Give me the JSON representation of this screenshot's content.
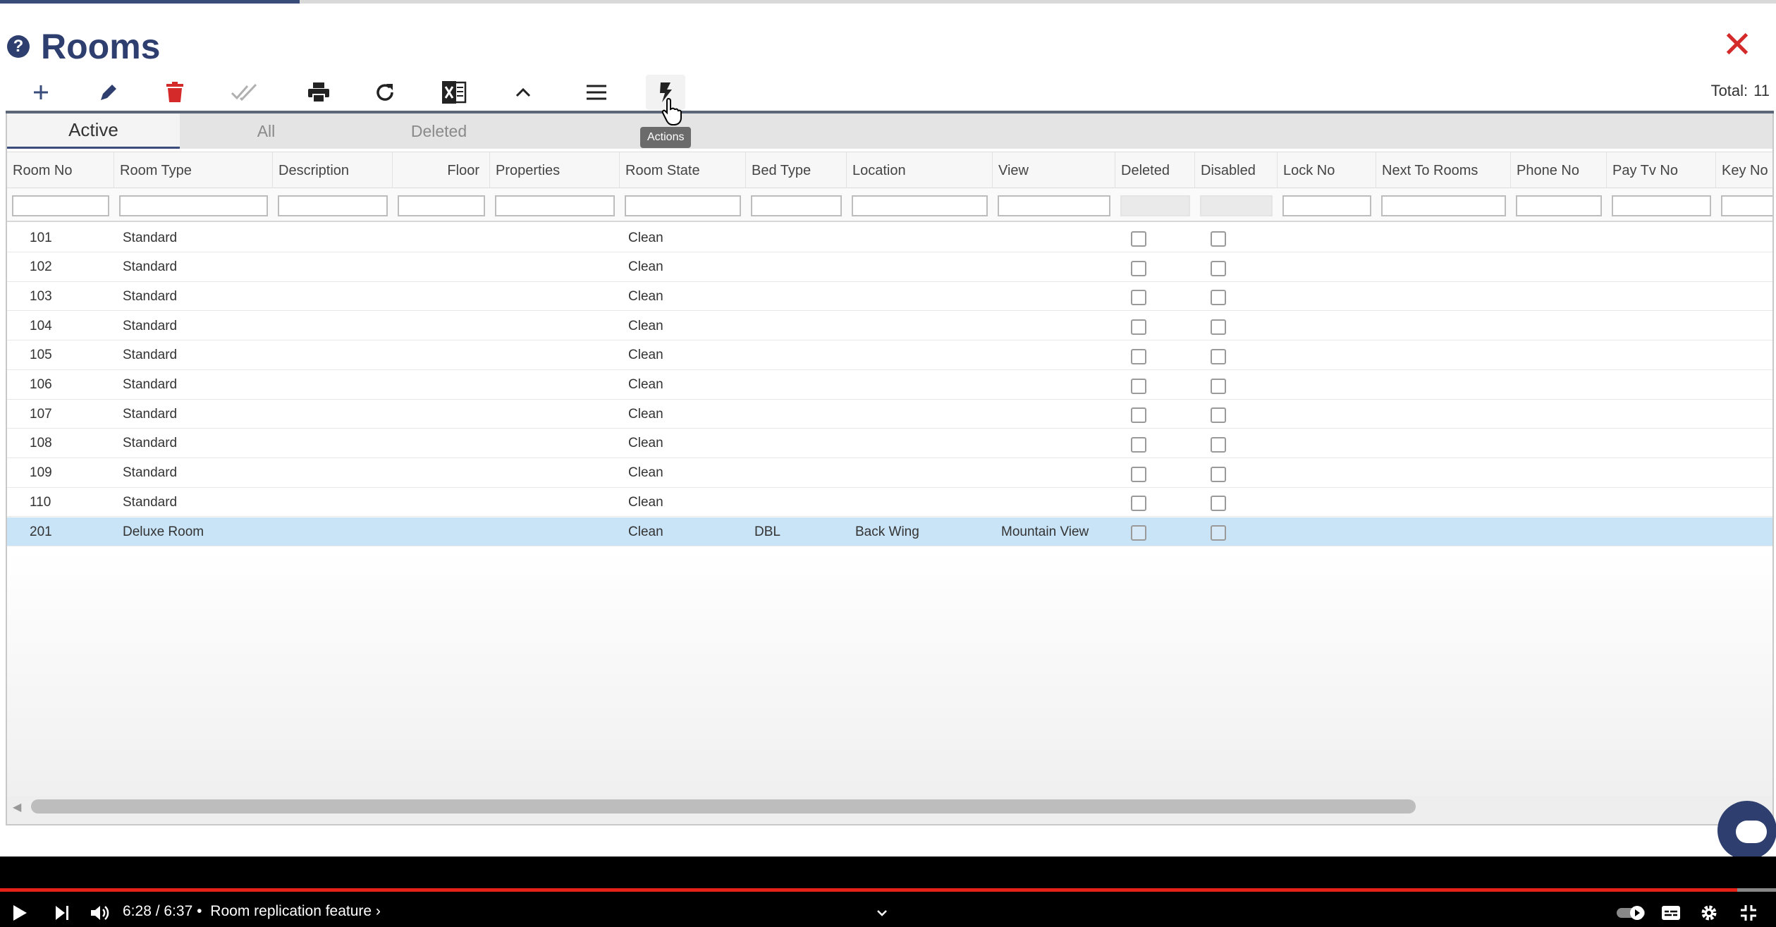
{
  "page": {
    "title": "Rooms",
    "help_icon": "?",
    "close_icon": "✕"
  },
  "toolbar": {
    "buttons": [
      {
        "name": "add",
        "icon": "plus-icon",
        "color": "#3a4d7a"
      },
      {
        "name": "edit",
        "icon": "pencil-icon",
        "color": "#2e3f6f"
      },
      {
        "name": "delete",
        "icon": "trash-icon",
        "color": "#d42a2a"
      },
      {
        "name": "approve",
        "icon": "double-check-icon",
        "color": "#b0b0b0"
      },
      {
        "name": "print",
        "icon": "printer-icon",
        "color": "#222222"
      },
      {
        "name": "refresh",
        "icon": "refresh-icon",
        "color": "#222222"
      },
      {
        "name": "excel",
        "icon": "excel-icon",
        "color": "#222222"
      },
      {
        "name": "collapse",
        "icon": "chevron-up-icon",
        "color": "#222222"
      },
      {
        "name": "menu",
        "icon": "hamburger-icon",
        "color": "#222222"
      },
      {
        "name": "actions",
        "icon": "bolt-icon",
        "color": "#222222"
      }
    ],
    "tooltip": "Actions",
    "total_label": "Total:",
    "total_value": "11"
  },
  "tabs": [
    {
      "label": "Active",
      "active": true
    },
    {
      "label": "All",
      "active": false
    },
    {
      "label": "Deleted",
      "active": false
    }
  ],
  "columns": [
    "Room No",
    "Room Type",
    "Description",
    "Floor",
    "Properties",
    "Room State",
    "Bed Type",
    "Location",
    "View",
    "Deleted",
    "Disabled",
    "Lock No",
    "Next To Rooms",
    "Phone No",
    "Pay Tv No",
    "Key No"
  ],
  "rows": [
    {
      "room_no": "101",
      "room_type": "Standard",
      "room_state": "Clean",
      "bed_type": "",
      "location": "",
      "view": "",
      "selected": false
    },
    {
      "room_no": "102",
      "room_type": "Standard",
      "room_state": "Clean",
      "bed_type": "",
      "location": "",
      "view": "",
      "selected": false
    },
    {
      "room_no": "103",
      "room_type": "Standard",
      "room_state": "Clean",
      "bed_type": "",
      "location": "",
      "view": "",
      "selected": false
    },
    {
      "room_no": "104",
      "room_type": "Standard",
      "room_state": "Clean",
      "bed_type": "",
      "location": "",
      "view": "",
      "selected": false
    },
    {
      "room_no": "105",
      "room_type": "Standard",
      "room_state": "Clean",
      "bed_type": "",
      "location": "",
      "view": "",
      "selected": false
    },
    {
      "room_no": "106",
      "room_type": "Standard",
      "room_state": "Clean",
      "bed_type": "",
      "location": "",
      "view": "",
      "selected": false
    },
    {
      "room_no": "107",
      "room_type": "Standard",
      "room_state": "Clean",
      "bed_type": "",
      "location": "",
      "view": "",
      "selected": false
    },
    {
      "room_no": "108",
      "room_type": "Standard",
      "room_state": "Clean",
      "bed_type": "",
      "location": "",
      "view": "",
      "selected": false
    },
    {
      "room_no": "109",
      "room_type": "Standard",
      "room_state": "Clean",
      "bed_type": "",
      "location": "",
      "view": "",
      "selected": false
    },
    {
      "room_no": "110",
      "room_type": "Standard",
      "room_state": "Clean",
      "bed_type": "",
      "location": "",
      "view": "",
      "selected": false
    },
    {
      "room_no": "201",
      "room_type": "Deluxe Room",
      "room_state": "Clean",
      "bed_type": "DBL",
      "location": "Back Wing",
      "view": "Mountain View",
      "selected": true
    }
  ],
  "video": {
    "time": "6:28 / 6:37",
    "separator": "•",
    "chapter": "Room replication feature ›",
    "progress_fraction": 0.978,
    "accent": "#e62117"
  },
  "colors": {
    "brand": "#2e3f6f",
    "danger": "#d42a2a",
    "selection": "#c9e3f7"
  }
}
